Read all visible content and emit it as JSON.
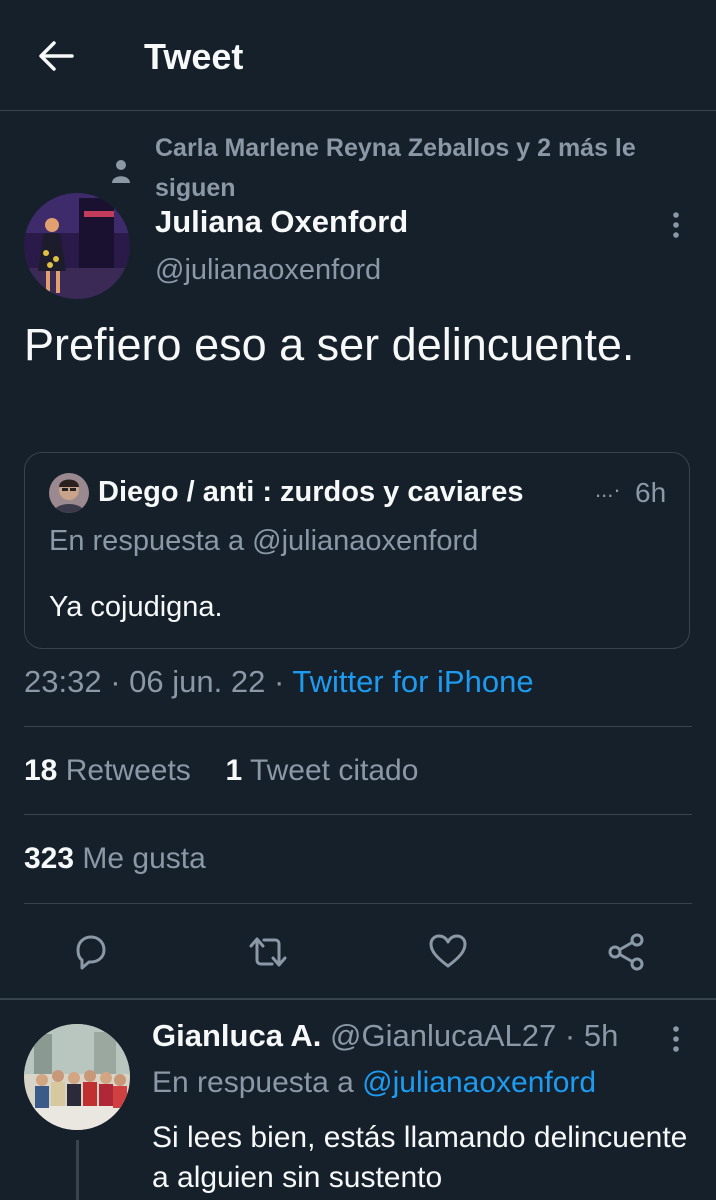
{
  "header": {
    "title": "Tweet"
  },
  "social_context": {
    "text": "Carla Marlene Reyna Zeballos y 2 más le siguen"
  },
  "author": {
    "name": "Juliana Oxenford",
    "handle": "@julianaoxenford"
  },
  "tweet": {
    "text": "Prefiero eso a ser delincuente."
  },
  "quote": {
    "name": "Diego / anti : zurdos y caviares",
    "ellipsis": "...·",
    "time": "6h",
    "reply_prefix": "En respuesta a",
    "reply_handle": "@julianaoxenford",
    "text": "Ya cojudigna."
  },
  "meta": {
    "time": "23:32",
    "sep": "·",
    "date": "06 jun. 22",
    "source": "Twitter for iPhone"
  },
  "stats": {
    "retweets_count": "18",
    "retweets_label": "Retweets",
    "quotes_count": "1",
    "quotes_label": "Tweet citado",
    "likes_count": "323",
    "likes_label": "Me gusta"
  },
  "icons": {
    "back": "arrow-left-icon",
    "follow": "person-icon",
    "more": "more-vertical-icon",
    "reply": "reply-icon",
    "retweet": "retweet-icon",
    "like": "heart-icon",
    "share": "share-icon"
  },
  "colors": {
    "background": "#15202b",
    "accent": "#1d9bf0",
    "muted": "#8b98a5",
    "border": "#38444d",
    "text": "#f7f9f9"
  },
  "reply": {
    "name": "Gianluca A.",
    "handle": "@GianlucaAL27",
    "sep": "·",
    "time": "5h",
    "reply_prefix": "En respuesta a",
    "reply_handle": "@julianaoxenford",
    "text": "Si lees bien, estás llamando delincuente a alguien sin sustento"
  }
}
